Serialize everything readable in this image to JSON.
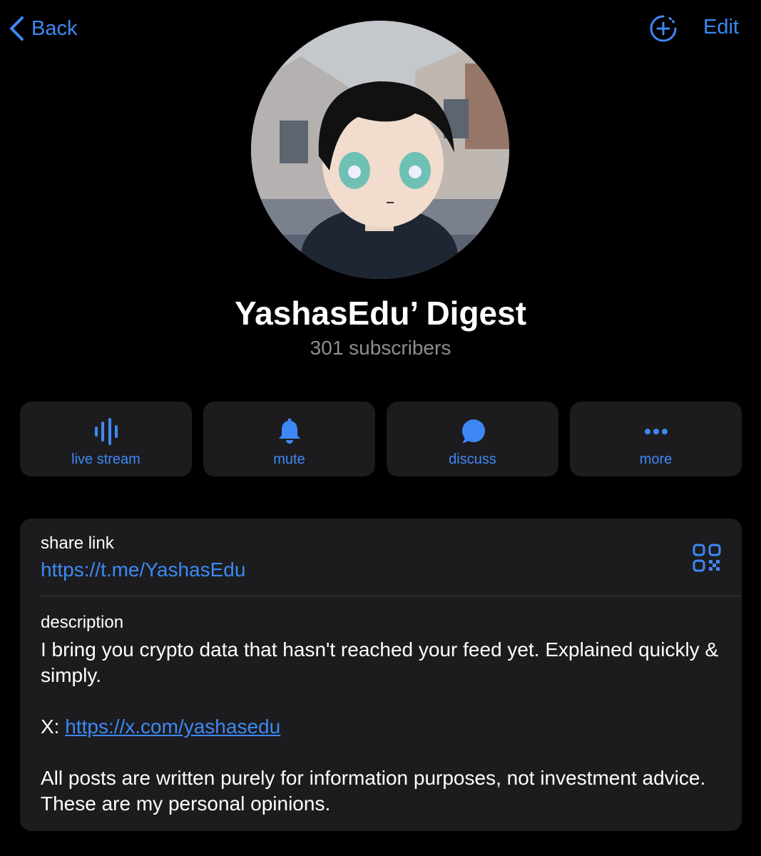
{
  "nav": {
    "back_label": "Back",
    "edit_label": "Edit"
  },
  "channel": {
    "name": "YashasEdu’ Digest",
    "subscribers": "301 subscribers"
  },
  "actions": [
    {
      "label": "live stream",
      "icon": "live-stream-icon"
    },
    {
      "label": "mute",
      "icon": "bell-icon"
    },
    {
      "label": "discuss",
      "icon": "speech-bubble-icon"
    },
    {
      "label": "more",
      "icon": "ellipsis-icon"
    }
  ],
  "info": {
    "share_label": "share link",
    "share_url": "https://t.me/YashasEdu",
    "description_label": "description",
    "description_line1": "I bring you crypto data that hasn't reached your feed yet. Explained quickly & simply.",
    "x_prefix": "X: ",
    "x_link": "https://x.com/yashasedu",
    "description_line3": "All posts are written purely for information purposes, not investment advice. These are my personal opinions."
  },
  "colors": {
    "accent": "#3e88f5",
    "background": "#000000",
    "card": "#1c1c1e",
    "secondary_text": "#8d8d93"
  }
}
